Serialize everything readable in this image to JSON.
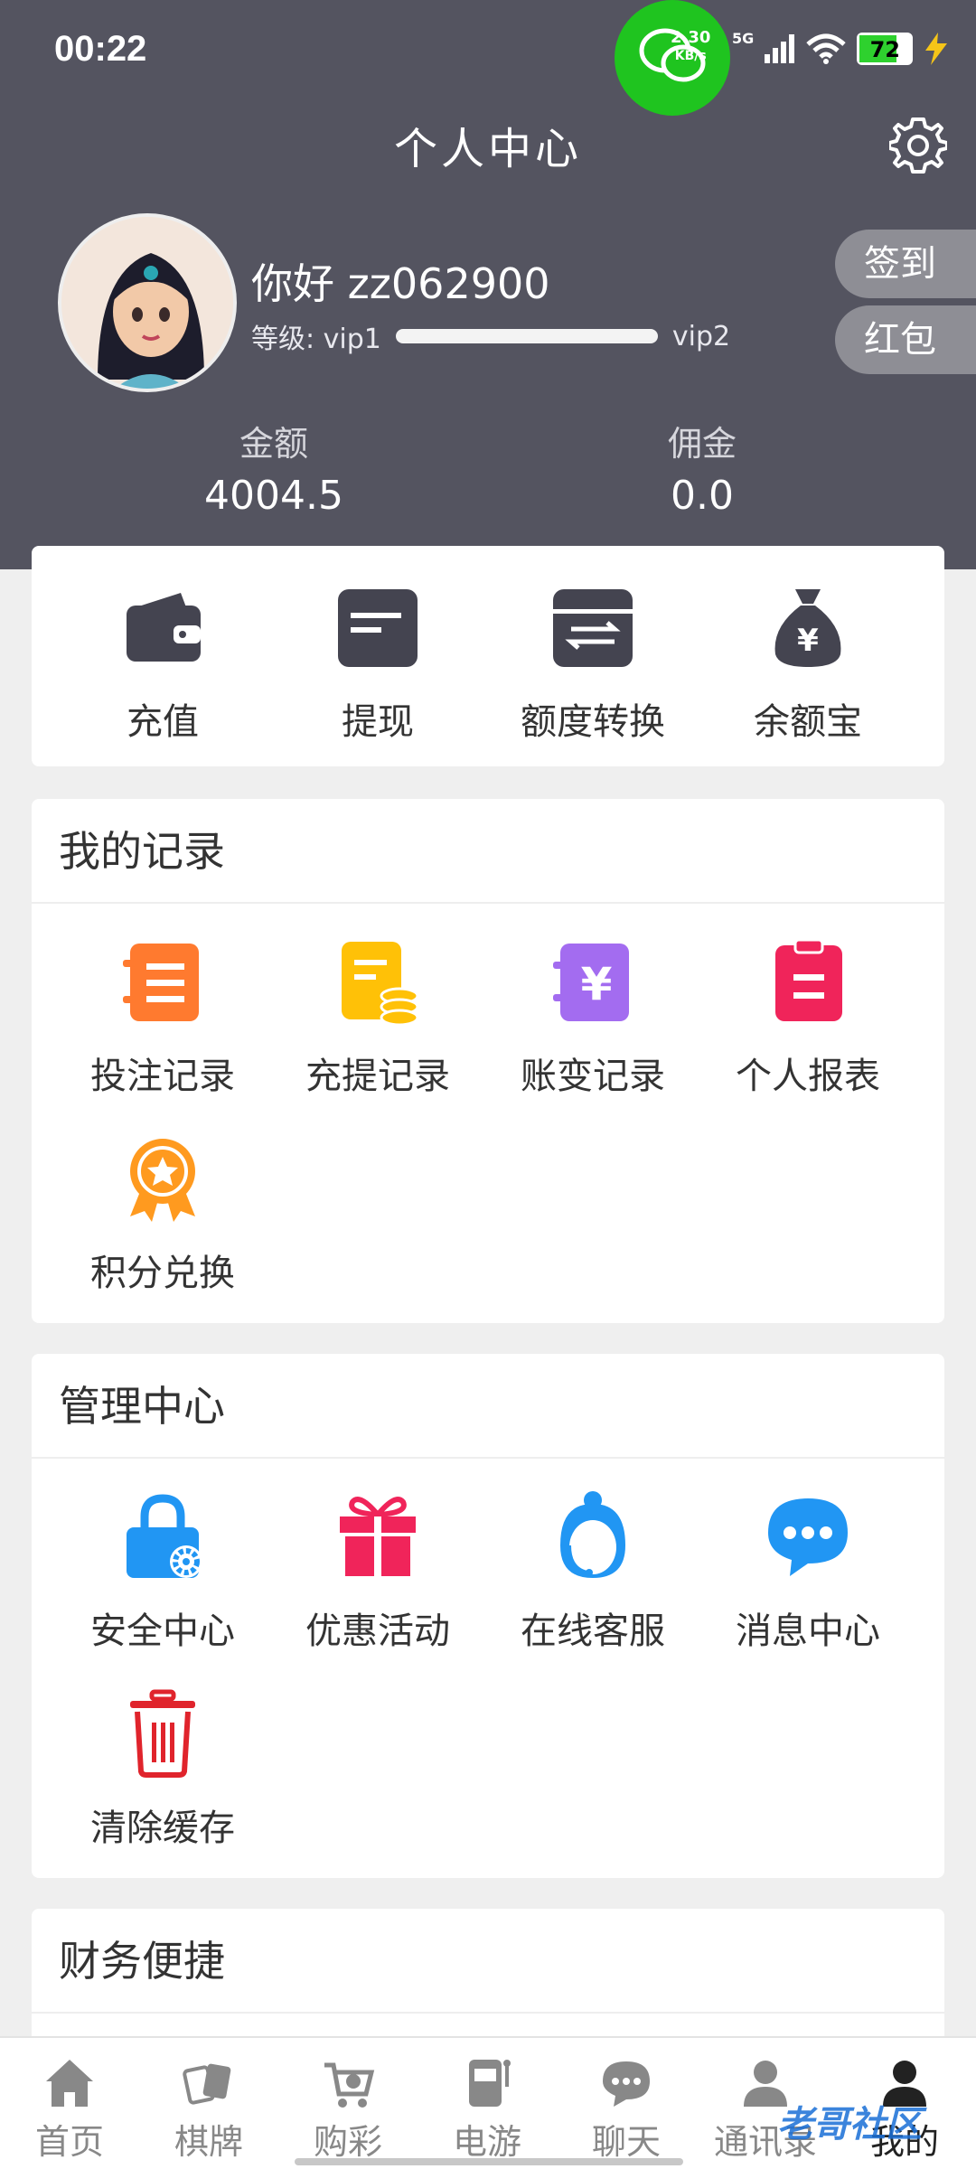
{
  "status": {
    "time": "00:22",
    "net_speed_top": "2.30",
    "net_speed_bottom": "KB/s",
    "network": "5G",
    "battery": "72"
  },
  "header": {
    "title": "个人中心"
  },
  "user": {
    "greeting": "你好 zz062900",
    "level_label": "等级: vip1",
    "next_level": "vip2",
    "level_progress": 0
  },
  "side_buttons": {
    "checkin": "签到",
    "redpacket": "红包"
  },
  "stats": {
    "balance_label": "金额",
    "balance_value": "4004.5",
    "commission_label": "佣金",
    "commission_value": "0.0"
  },
  "wallet": [
    {
      "label": "充值",
      "icon": "wallet-icon"
    },
    {
      "label": "提现",
      "icon": "card-icon"
    },
    {
      "label": "额度转换",
      "icon": "transfer-icon"
    },
    {
      "label": "余额宝",
      "icon": "money-bag-icon"
    }
  ],
  "records": {
    "title": "我的记录",
    "items": [
      {
        "label": "投注记录",
        "icon": "bet-record-icon",
        "color": "#ff7a2f"
      },
      {
        "label": "充提记录",
        "icon": "deposit-record-icon",
        "color": "#ffc107"
      },
      {
        "label": "账变记录",
        "icon": "account-change-icon",
        "color": "#a36cf0"
      },
      {
        "label": "个人报表",
        "icon": "report-icon",
        "color": "#f0245a"
      },
      {
        "label": "积分兑换",
        "icon": "points-medal-icon",
        "color": "#ff9a1f"
      }
    ]
  },
  "management": {
    "title": "管理中心",
    "items": [
      {
        "label": "安全中心",
        "icon": "lock-icon",
        "color": "#2196f3"
      },
      {
        "label": "优惠活动",
        "icon": "gift-icon",
        "color": "#f0245a"
      },
      {
        "label": "在线客服",
        "icon": "customer-service-icon",
        "color": "#2196f3"
      },
      {
        "label": "消息中心",
        "icon": "chat-bubble-icon",
        "color": "#2196f3"
      },
      {
        "label": "清除缓存",
        "icon": "trash-icon",
        "color": "#e0242c"
      }
    ]
  },
  "finance": {
    "title": "财务便捷"
  },
  "nav": [
    {
      "label": "首页",
      "icon": "home-icon"
    },
    {
      "label": "棋牌",
      "icon": "cards-icon"
    },
    {
      "label": "购彩",
      "icon": "cart-icon"
    },
    {
      "label": "电游",
      "icon": "slot-machine-icon"
    },
    {
      "label": "聊天",
      "icon": "chat-icon"
    },
    {
      "label": "通讯录",
      "icon": "contacts-icon"
    },
    {
      "label": "我的",
      "icon": "profile-icon"
    }
  ],
  "watermark": "老哥社区",
  "colors": {
    "header_bg": "#545460",
    "icon_dark": "#444450"
  }
}
